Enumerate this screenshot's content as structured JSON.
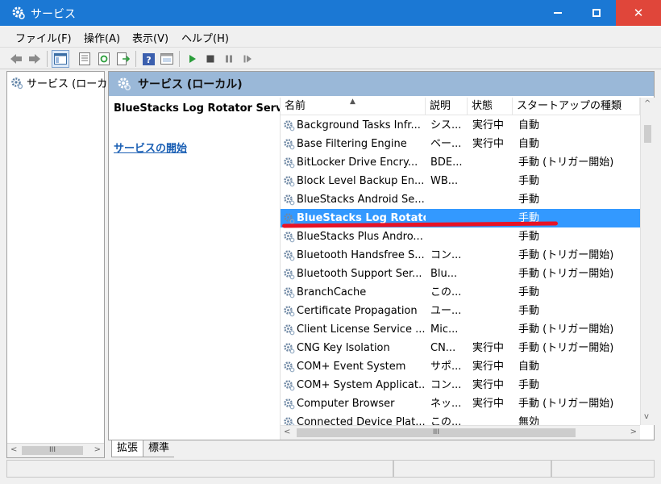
{
  "window": {
    "title": "サービス"
  },
  "menu": [
    "ファイル(F)",
    "操作(A)",
    "表示(V)",
    "ヘルプ(H)"
  ],
  "toolbar": [
    "back-icon",
    "forward-icon",
    "console-tree-icon",
    "properties-icon",
    "refresh-icon",
    "export-icon",
    "help-icon",
    "view-icon",
    "play-icon",
    "stop-icon",
    "pause-icon",
    "restart-icon"
  ],
  "tree": {
    "root_label": "サービス (ローカル)"
  },
  "pane": {
    "header": "サービス (ローカル)",
    "selected_service_title": "BlueStacks Log Rotator Service",
    "start_link": "サービスの開始"
  },
  "columns": {
    "name": "名前",
    "desc": "説明",
    "state": "状態",
    "startup": "スタートアップの種類"
  },
  "services": [
    {
      "name": "Background Tasks Infr...",
      "desc": "シス...",
      "state": "実行中",
      "startup": "自動"
    },
    {
      "name": "Base Filtering Engine",
      "desc": "ベー...",
      "state": "実行中",
      "startup": "自動"
    },
    {
      "name": "BitLocker Drive Encry...",
      "desc": "BDE...",
      "state": "",
      "startup": "手動 (トリガー開始)"
    },
    {
      "name": "Block Level Backup En...",
      "desc": "WB...",
      "state": "",
      "startup": "手動"
    },
    {
      "name": "BlueStacks Android Se...",
      "desc": "",
      "state": "",
      "startup": "手動"
    },
    {
      "name": "BlueStacks Log Rotato...",
      "desc": "",
      "state": "",
      "startup": "手動",
      "selected": true
    },
    {
      "name": "BlueStacks Plus Andro...",
      "desc": "",
      "state": "",
      "startup": "手動"
    },
    {
      "name": "Bluetooth Handsfree S...",
      "desc": "コン...",
      "state": "",
      "startup": "手動 (トリガー開始)"
    },
    {
      "name": "Bluetooth Support Ser...",
      "desc": "Blu...",
      "state": "",
      "startup": "手動 (トリガー開始)"
    },
    {
      "name": "BranchCache",
      "desc": "この...",
      "state": "",
      "startup": "手動"
    },
    {
      "name": "Certificate Propagation",
      "desc": "ユー...",
      "state": "",
      "startup": "手動"
    },
    {
      "name": "Client License Service ...",
      "desc": "Mic...",
      "state": "",
      "startup": "手動 (トリガー開始)"
    },
    {
      "name": "CNG Key Isolation",
      "desc": "CN...",
      "state": "実行中",
      "startup": "手動 (トリガー開始)"
    },
    {
      "name": "COM+ Event System",
      "desc": "サポ...",
      "state": "実行中",
      "startup": "自動"
    },
    {
      "name": "COM+ System Applicat...",
      "desc": "コン...",
      "state": "実行中",
      "startup": "手動"
    },
    {
      "name": "Computer Browser",
      "desc": "ネッ...",
      "state": "実行中",
      "startup": "手動 (トリガー開始)"
    },
    {
      "name": "Connected Device Plat...",
      "desc": "この...",
      "state": "",
      "startup": "無効"
    }
  ],
  "tabs": [
    "拡張",
    "標準"
  ],
  "colors": {
    "titlebar": "#1b78d4",
    "close": "#e0463a",
    "header": "#9ab8d8",
    "selection": "#3399ff",
    "annotation": "#e81224"
  }
}
